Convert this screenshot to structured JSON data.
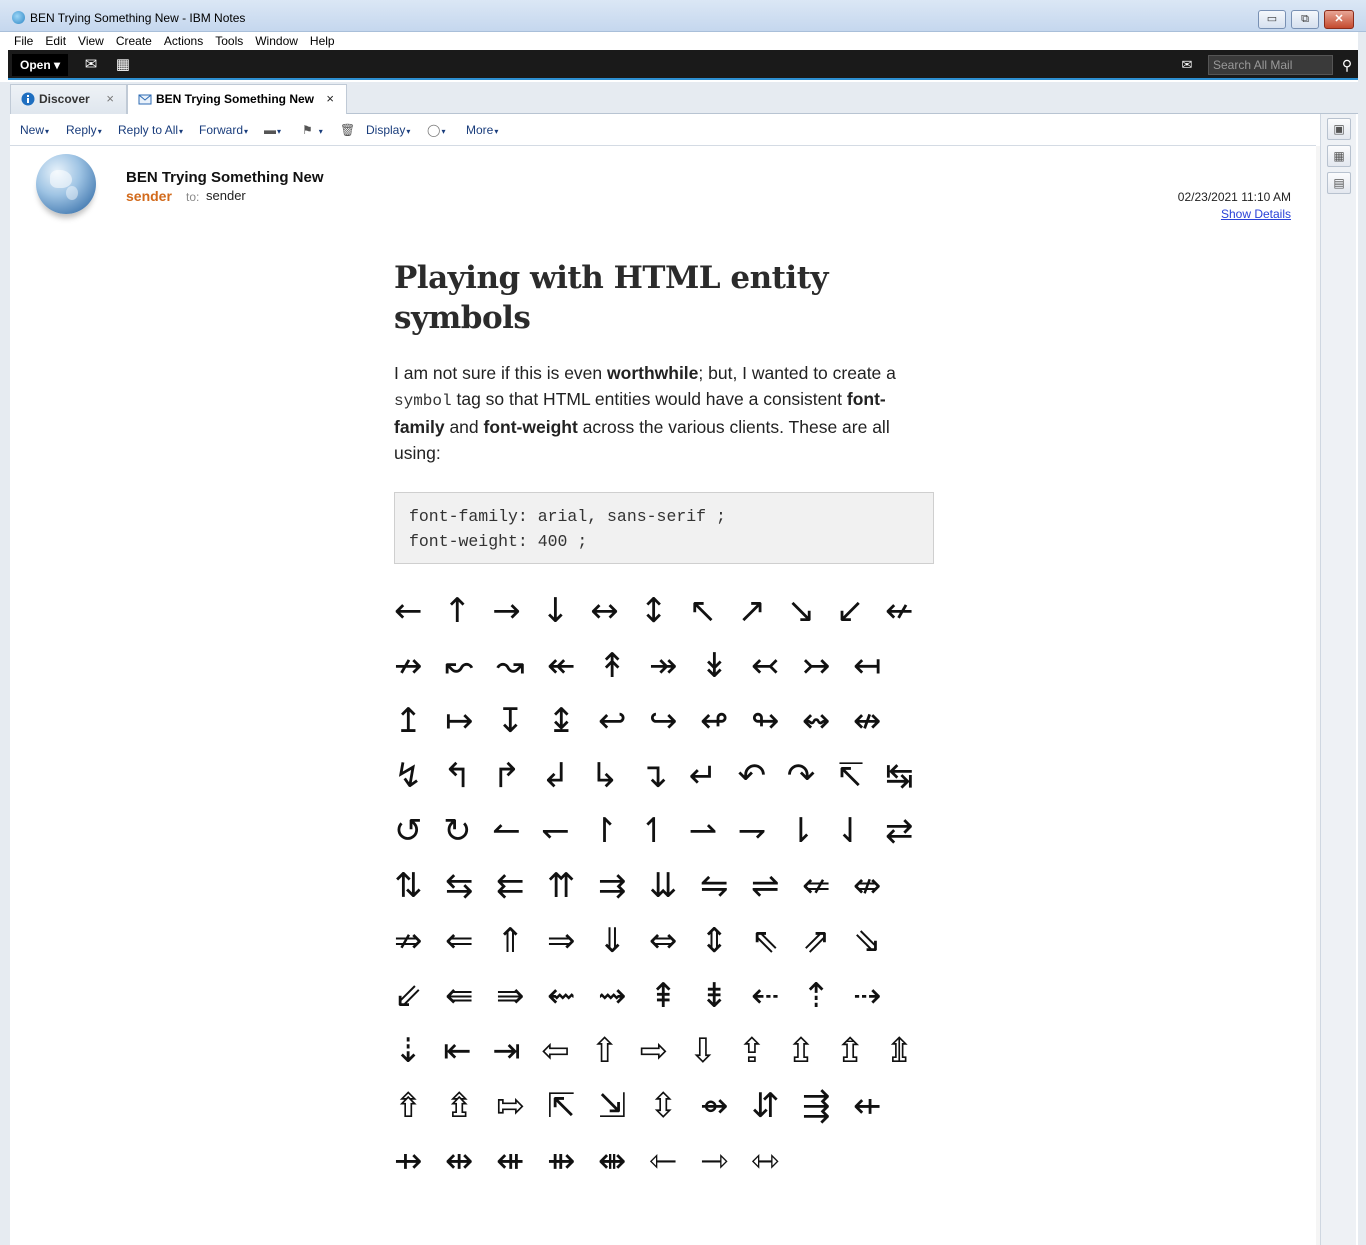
{
  "window": {
    "title": "BEN Trying Something New - IBM Notes",
    "controls": [
      "▭",
      "⧉",
      "✕"
    ]
  },
  "menu": [
    "File",
    "Edit",
    "View",
    "Create",
    "Actions",
    "Tools",
    "Window",
    "Help"
  ],
  "toolbar": {
    "open_label": "Open ▾",
    "mail_icon": "✉",
    "calendar_icon": "▦",
    "search_mail_icon": "✉",
    "search_placeholder": "Search All Mail",
    "search_icon": "⚲"
  },
  "tabs": [
    {
      "label": "Discover",
      "close": "×",
      "active": false
    },
    {
      "label": "BEN Trying Something New",
      "close": "×",
      "active": true
    }
  ],
  "actions": [
    {
      "label": "New",
      "caret": "▾"
    },
    {
      "label": "Reply",
      "caret": "▾"
    },
    {
      "label": "Reply to All",
      "caret": "▾"
    },
    {
      "label": "Forward",
      "caret": "▾"
    },
    {
      "label": "▬",
      "caret": "▾"
    },
    {
      "label": "⚑",
      "caret": "▾"
    },
    {
      "label": "🗑",
      "caret": ""
    },
    {
      "label": "Display",
      "caret": "▾"
    },
    {
      "label": "◯",
      "caret": "▾"
    },
    {
      "label": "More",
      "caret": "▾"
    }
  ],
  "sidebar_icons": [
    "▣",
    "▦",
    "▤"
  ],
  "message": {
    "subject": "BEN Trying Something New",
    "from": "sender",
    "to_label": "to:",
    "to": "sender",
    "date": "02/23/2021 11:10 AM",
    "show_details": "Show Details"
  },
  "post": {
    "title": "Playing with HTML entity symbols",
    "para_1": "I am not sure if this is even ",
    "bold_1": "worthwhile",
    "para_2": "; but, I wanted to create a ",
    "code_1": "symbol",
    "para_3": " tag so that HTML entities would have a consistent ",
    "bold_2": "font-family",
    "para_4": " and ",
    "bold_3": "font-weight",
    "para_5": " across the various clients. These are all using:",
    "code_line_1": "font-family: arial, sans-serif ;",
    "code_line_2": "font-weight: 400 ;"
  },
  "arrows": [
    [
      "←",
      "↑",
      "→",
      "↓",
      "↔",
      "↕",
      "↖",
      "↗",
      "↘",
      "↙",
      "↚"
    ],
    [
      "↛",
      "↜",
      "↝",
      "↞",
      "↟",
      "↠",
      "↡",
      "↢",
      "↣",
      "↤"
    ],
    [
      "↥",
      "↦",
      "↧",
      "↨",
      "↩",
      "↪",
      "↫",
      "↬",
      "↭",
      "↮"
    ],
    [
      "↯",
      "↰",
      "↱",
      "↲",
      "↳",
      "↴",
      "↵",
      "↶",
      "↷",
      "↸",
      "↹"
    ],
    [
      "↺",
      "↻",
      "↼",
      "↽",
      "↾",
      "↿",
      "⇀",
      "⇁",
      "⇂",
      "⇃",
      "⇄"
    ],
    [
      "⇅",
      "⇆",
      "⇇",
      "⇈",
      "⇉",
      "⇊",
      "⇋",
      "⇌",
      "⇍",
      "⇎"
    ],
    [
      "⇏",
      "⇐",
      "⇑",
      "⇒",
      "⇓",
      "⇔",
      "⇕",
      "⇖",
      "⇗",
      "⇘"
    ],
    [
      "⇙",
      "⇚",
      "⇛",
      "⇜",
      "⇝",
      "⇞",
      "⇟",
      "⇠",
      "⇡",
      "⇢"
    ],
    [
      "⇣",
      "⇤",
      "⇥",
      "⇦",
      "⇧",
      "⇨",
      "⇩",
      "⇪",
      "⇫",
      "⇬",
      "⇭"
    ],
    [
      "⇮",
      "⇯",
      "⇰",
      "⇱",
      "⇲",
      "⇳",
      "⇴",
      "⇵",
      "⇶",
      "⇷"
    ],
    [
      "⇸",
      "⇹",
      "⇺",
      "⇻",
      "⇼",
      "⇽",
      "⇾",
      "⇿"
    ]
  ]
}
